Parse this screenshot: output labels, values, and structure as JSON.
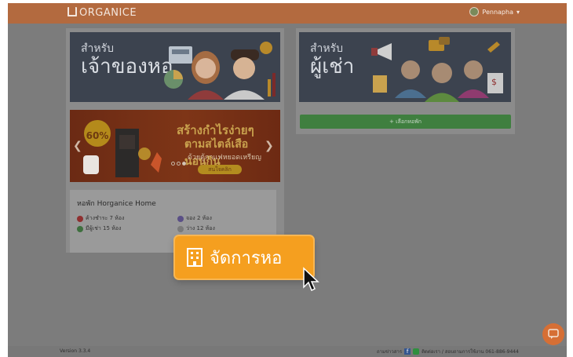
{
  "topbar": {
    "logo": "ORGANICE",
    "user": "Pennapha"
  },
  "owner_card": {
    "small": "สำหรับ",
    "big": "เจ้าของหอ"
  },
  "tenant_card": {
    "small": "สำหรับ",
    "big": "ผู้เช่า",
    "button": "+ เลือกหอพัก"
  },
  "banner": {
    "badge": "60%",
    "line1": "สร้างกำไรง่ายๆ",
    "line2": "ตามสไตล์เสือนอนกิน",
    "line3": "ด้วยตู้กาแฟหยอดเหรียญ",
    "cta": "สนใจคลิก"
  },
  "dorm": {
    "title": "หอพัก Horganice Home",
    "stats": [
      {
        "text": "ค้างชำระ 7 ห้อง",
        "color": "#8f2f2f"
      },
      {
        "text": "จอง 2 ห้อง",
        "color": "#5a4f86"
      },
      {
        "text": "มีผู้เช่า 15 ห้อง",
        "color": "#3e6f3e"
      },
      {
        "text": "ว่าง 12 ห้อง",
        "color": "#7a7a7a"
      }
    ]
  },
  "highlight": {
    "label": "จัดการหอ"
  },
  "footer": {
    "version": "Version 3.3.4",
    "contact": "ถามข่าวสาร",
    "line_text": "ติดต่อเรา / สอบถามการใช้งาน 061-886-9444"
  }
}
